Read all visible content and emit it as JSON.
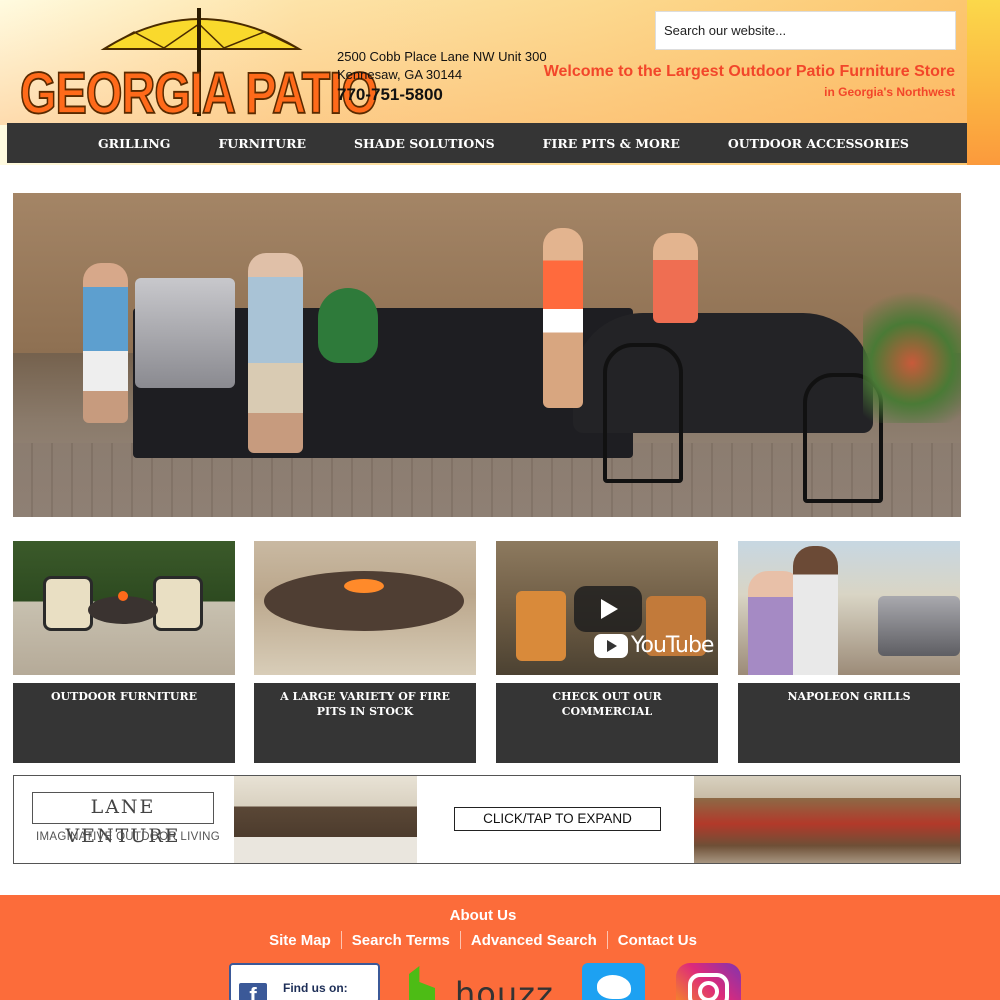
{
  "header": {
    "logo_text": "GEORGIA PATIO",
    "address_line1": "2500 Cobb Place Lane NW Unit 300",
    "address_line2": "Kennesaw, GA 30144",
    "phone": "770-751-5800",
    "search_placeholder": "Search our website...",
    "welcome": "Welcome to the Largest Outdoor Patio Furniture Store",
    "welcome_sub": "in Georgia's Northwest"
  },
  "nav": {
    "items": [
      "GRILLING",
      "FURNITURE",
      "SHADE SOLUTIONS",
      "FIRE PITS & MORE",
      "OUTDOOR ACCESSORIES"
    ]
  },
  "tiles": [
    {
      "caption": "OUTDOOR FURNITURE"
    },
    {
      "caption": "A LARGE VARIETY OF FIRE PITS IN STOCK"
    },
    {
      "caption": "CHECK OUT OUR COMMERCIAL"
    },
    {
      "caption": "NAPOLEON GRILLS"
    }
  ],
  "youtube_word": "YouTube",
  "banner": {
    "brand": "LANE VENTURE",
    "tagline": "IMAGINATIVE OUTDOOR LIVING",
    "expand_label": "CLICK/TAP TO EXPAND"
  },
  "footer": {
    "about": "About Us",
    "links": [
      "Site Map",
      "Search Terms",
      "Advanced Search",
      "Contact Us"
    ],
    "facebook_text": "Find us on:",
    "houzz_word": "houzz"
  },
  "colors": {
    "nav_bg": "#353535",
    "accent_red": "#f2462a",
    "footer_bg": "#fc6c3a",
    "logo_orange": "#ff6a1a"
  }
}
